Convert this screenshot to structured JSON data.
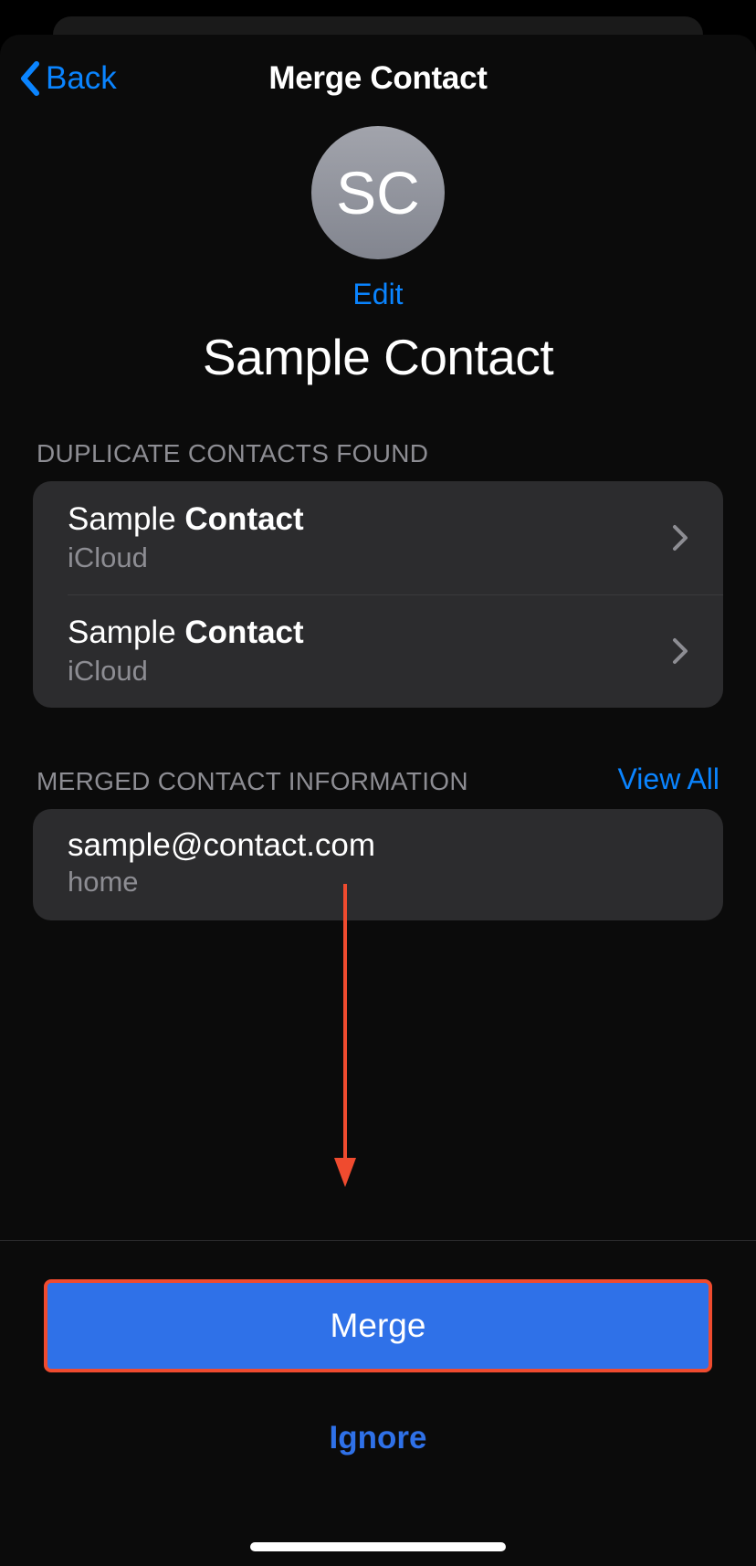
{
  "nav": {
    "back_label": "Back",
    "title": "Merge Contact"
  },
  "contact": {
    "initials": "SC",
    "edit_label": "Edit",
    "name": "Sample Contact"
  },
  "duplicates": {
    "section_label": "DUPLICATE CONTACTS FOUND",
    "items": [
      {
        "name_prefix": "Sample ",
        "name_bold": "Contact",
        "source": "iCloud"
      },
      {
        "name_prefix": "Sample ",
        "name_bold": "Contact",
        "source": "iCloud"
      }
    ]
  },
  "merged_info": {
    "section_label": "MERGED CONTACT INFORMATION",
    "view_all_label": "View All",
    "email": "sample@contact.com",
    "email_label": "home"
  },
  "actions": {
    "merge_label": "Merge",
    "ignore_label": "Ignore"
  }
}
